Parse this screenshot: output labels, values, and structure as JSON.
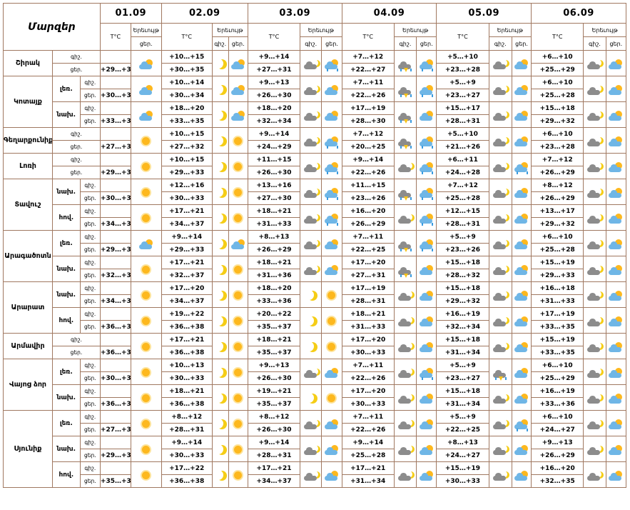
{
  "table_title": "Մարզեր",
  "header_labels": {
    "temp": "T°C",
    "weather": "Երեւույթ",
    "day": "ցեր.",
    "night": "գիշ."
  },
  "dates": [
    "01.09",
    "02.09",
    "03.09",
    "04.09",
    "05.09",
    "06.09"
  ],
  "icon_legend": {
    "sun": "sunny",
    "moon": "clear-night",
    "sun-cloud": "partly-cloudy-day",
    "moon-cloud": "partly-cloudy-night",
    "sun-cloud-rain": "sun-cloud-rain",
    "cloud-rain-thunder": "thunderstorm-rain"
  },
  "colors": {
    "border": "#a07860",
    "sun": "#fdb81e",
    "moon": "#f5cd16",
    "cloud_light": "#6fb6e6",
    "cloud_dark": "#8c8c8c",
    "rain": "#3a9be0"
  },
  "regions": [
    {
      "name": "Շիրակ",
      "subs": [
        {
          "label": "",
          "night_label": "գիշ.",
          "day_label": "ցեր.",
          "d1": {
            "temp": "+29…+34",
            "icon": "sun-cloud"
          },
          "days": [
            {
              "night": "+10…+15",
              "day": "+30…+35",
              "night_icon": "moon",
              "day_icon": "sun-cloud"
            },
            {
              "night": "+9…+14",
              "day": "+27…+31",
              "night_icon": "moon-cloud",
              "day_icon": "sun-cloud-rain"
            },
            {
              "night": "+7…+12",
              "day": "+22…+27",
              "night_icon": "cloud-rain-thunder",
              "day_icon": "sun-cloud-rain"
            },
            {
              "night": "+5…+10",
              "day": "+23…+28",
              "night_icon": "moon-cloud",
              "day_icon": "sun-cloud"
            },
            {
              "night": "+6…+10",
              "day": "+25…+29",
              "night_icon": "moon-cloud",
              "day_icon": "sun-cloud"
            }
          ]
        }
      ]
    },
    {
      "name": "Կոտայք",
      "subs": [
        {
          "label": "լեռ.",
          "night_label": "գիշ.",
          "day_label": "ցեր.",
          "d1": {
            "temp": "+30…+33",
            "icon": "sun-cloud"
          },
          "days": [
            {
              "night": "+10…+14",
              "day": "+30…+34",
              "night_icon": "moon",
              "day_icon": "sun-cloud"
            },
            {
              "night": "+9…+13",
              "day": "+26…+30",
              "night_icon": "moon-cloud",
              "day_icon": "sun-cloud"
            },
            {
              "night": "+7…+11",
              "day": "+22…+26",
              "night_icon": "cloud-rain-thunder",
              "day_icon": "sun-cloud-rain"
            },
            {
              "night": "+5…+9",
              "day": "+23…+27",
              "night_icon": "moon-cloud",
              "day_icon": "sun-cloud"
            },
            {
              "night": "+6…+10",
              "day": "+25…+28",
              "night_icon": "moon-cloud",
              "day_icon": "sun-cloud"
            }
          ]
        },
        {
          "label": "նախ.",
          "night_label": "գիշ.",
          "day_label": "ցեր.",
          "d1": {
            "temp": "+33…+35",
            "icon": "sun-cloud"
          },
          "days": [
            {
              "night": "+18…+20",
              "day": "+33…+35",
              "night_icon": "moon",
              "day_icon": "sun-cloud"
            },
            {
              "night": "+18…+20",
              "day": "+32…+34",
              "night_icon": "moon-cloud",
              "day_icon": "sun-cloud"
            },
            {
              "night": "+17…+19",
              "day": "+28…+30",
              "night_icon": "cloud-rain-thunder",
              "day_icon": "sun-cloud"
            },
            {
              "night": "+15…+17",
              "day": "+28…+31",
              "night_icon": "moon-cloud",
              "day_icon": "sun-cloud"
            },
            {
              "night": "+15…+18",
              "day": "+29…+32",
              "night_icon": "moon-cloud",
              "day_icon": "sun-cloud"
            }
          ]
        }
      ]
    },
    {
      "name": "Գեղարքունիք",
      "subs": [
        {
          "label": "",
          "night_label": "գիշ.",
          "day_label": "ցեր.",
          "d1": {
            "temp": "+27…+32",
            "icon": "sun"
          },
          "days": [
            {
              "night": "+10…+15",
              "day": "+27…+32",
              "night_icon": "moon",
              "day_icon": "sun"
            },
            {
              "night": "+9…+14",
              "day": "+24…+29",
              "night_icon": "moon-cloud",
              "day_icon": "sun-cloud-rain"
            },
            {
              "night": "+7…+12",
              "day": "+20…+25",
              "night_icon": "cloud-rain-thunder",
              "day_icon": "sun-cloud-rain"
            },
            {
              "night": "+5…+10",
              "day": "+21…+26",
              "night_icon": "moon-cloud",
              "day_icon": "sun-cloud"
            },
            {
              "night": "+6…+10",
              "day": "+23…+28",
              "night_icon": "moon-cloud",
              "day_icon": "sun-cloud"
            }
          ]
        }
      ]
    },
    {
      "name": "Լոռի",
      "subs": [
        {
          "label": "",
          "night_label": "գիշ.",
          "day_label": "ցեր.",
          "d1": {
            "temp": "+29…+33",
            "icon": "sun"
          },
          "days": [
            {
              "night": "+10…+15",
              "day": "+29…+33",
              "night_icon": "moon",
              "day_icon": "sun"
            },
            {
              "night": "+11…+15",
              "day": "+26…+30",
              "night_icon": "moon-cloud",
              "day_icon": "sun-cloud-rain"
            },
            {
              "night": "+9…+14",
              "day": "+22…+26",
              "night_icon": "moon-cloud",
              "day_icon": "sun-cloud-rain"
            },
            {
              "night": "+6…+11",
              "day": "+24…+28",
              "night_icon": "moon-cloud",
              "day_icon": "sun-cloud-rain"
            },
            {
              "night": "+7…+12",
              "day": "+26…+29",
              "night_icon": "moon-cloud",
              "day_icon": "sun-cloud"
            }
          ]
        }
      ]
    },
    {
      "name": "Տավուշ",
      "subs": [
        {
          "label": "նախ.",
          "night_label": "գիշ.",
          "day_label": "ցեր.",
          "d1": {
            "temp": "+30…+33",
            "icon": "sun"
          },
          "days": [
            {
              "night": "+12…+16",
              "day": "+30…+33",
              "night_icon": "moon",
              "day_icon": "sun"
            },
            {
              "night": "+13…+16",
              "day": "+27…+30",
              "night_icon": "moon-cloud",
              "day_icon": "sun-cloud-rain"
            },
            {
              "night": "+11…+15",
              "day": "+23…+26",
              "night_icon": "cloud-rain-thunder",
              "day_icon": "sun-cloud-rain"
            },
            {
              "night": "+7…+12",
              "day": "+25…+28",
              "night_icon": "moon-cloud",
              "day_icon": "sun-cloud"
            },
            {
              "night": "+8…+12",
              "day": "+26…+29",
              "night_icon": "moon-cloud",
              "day_icon": "sun-cloud"
            }
          ]
        },
        {
          "label": "հով.",
          "night_label": "գիշ.",
          "day_label": "ցեր.",
          "d1": {
            "temp": "+34…+37",
            "icon": "sun"
          },
          "days": [
            {
              "night": "+17…+21",
              "day": "+34…+37",
              "night_icon": "moon",
              "day_icon": "sun"
            },
            {
              "night": "+18…+21",
              "day": "+31…+33",
              "night_icon": "moon-cloud",
              "day_icon": "sun-cloud-rain"
            },
            {
              "night": "+16…+20",
              "day": "+26…+29",
              "night_icon": "moon-cloud",
              "day_icon": "sun-cloud-rain"
            },
            {
              "night": "+12…+15",
              "day": "+28…+31",
              "night_icon": "moon-cloud",
              "day_icon": "sun-cloud"
            },
            {
              "night": "+13…+17",
              "day": "+29…+32",
              "night_icon": "moon-cloud",
              "day_icon": "sun-cloud"
            }
          ]
        }
      ]
    },
    {
      "name": "Արագածոտն",
      "subs": [
        {
          "label": "լեռ.",
          "night_label": "գիշ.",
          "day_label": "ցեր.",
          "d1": {
            "temp": "+29…+33",
            "icon": "sun-cloud"
          },
          "days": [
            {
              "night": "+9…+14",
              "day": "+29…+33",
              "night_icon": "moon",
              "day_icon": "sun-cloud"
            },
            {
              "night": "+8…+13",
              "day": "+26…+29",
              "night_icon": "moon-cloud",
              "day_icon": "sun-cloud"
            },
            {
              "night": "+7…+11",
              "day": "+22…+25",
              "night_icon": "cloud-rain-thunder",
              "day_icon": "sun-cloud-rain"
            },
            {
              "night": "+5…+9",
              "day": "+23…+26",
              "night_icon": "moon-cloud",
              "day_icon": "sun-cloud"
            },
            {
              "night": "+6…+10",
              "day": "+25…+28",
              "night_icon": "moon-cloud",
              "day_icon": "sun-cloud"
            }
          ]
        },
        {
          "label": "նախ.",
          "night_label": "գիշ.",
          "day_label": "ցեր.",
          "d1": {
            "temp": "+32…+37",
            "icon": "sun"
          },
          "days": [
            {
              "night": "+17…+21",
              "day": "+32…+37",
              "night_icon": "moon",
              "day_icon": "sun"
            },
            {
              "night": "+18…+21",
              "day": "+31…+36",
              "night_icon": "moon-cloud",
              "day_icon": "sun-cloud"
            },
            {
              "night": "+17…+20",
              "day": "+27…+31",
              "night_icon": "cloud-rain-thunder",
              "day_icon": "sun-cloud"
            },
            {
              "night": "+15…+18",
              "day": "+28…+32",
              "night_icon": "moon-cloud",
              "day_icon": "sun-cloud"
            },
            {
              "night": "+15…+19",
              "day": "+29…+33",
              "night_icon": "moon-cloud",
              "day_icon": "sun-cloud"
            }
          ]
        }
      ]
    },
    {
      "name": "Արարատ",
      "subs": [
        {
          "label": "նախ.",
          "night_label": "գիշ.",
          "day_label": "ցեր.",
          "d1": {
            "temp": "+34…+37",
            "icon": "sun"
          },
          "days": [
            {
              "night": "+17…+20",
              "day": "+34…+37",
              "night_icon": "moon",
              "day_icon": "sun"
            },
            {
              "night": "+18…+20",
              "day": "+33…+36",
              "night_icon": "moon",
              "day_icon": "sun"
            },
            {
              "night": "+17…+19",
              "day": "+28…+31",
              "night_icon": "moon-cloud",
              "day_icon": "sun-cloud"
            },
            {
              "night": "+15…+18",
              "day": "+29…+32",
              "night_icon": "moon-cloud",
              "day_icon": "sun-cloud"
            },
            {
              "night": "+16…+18",
              "day": "+31…+33",
              "night_icon": "moon-cloud",
              "day_icon": "sun-cloud"
            }
          ]
        },
        {
          "label": "հով.",
          "night_label": "գիշ.",
          "day_label": "ցեր.",
          "d1": {
            "temp": "+36…+38",
            "icon": "sun"
          },
          "days": [
            {
              "night": "+19…+22",
              "day": "+36…+38",
              "night_icon": "moon",
              "day_icon": "sun"
            },
            {
              "night": "+20…+22",
              "day": "+35…+37",
              "night_icon": "moon",
              "day_icon": "sun"
            },
            {
              "night": "+18…+21",
              "day": "+31…+33",
              "night_icon": "moon-cloud",
              "day_icon": "sun-cloud"
            },
            {
              "night": "+16…+19",
              "day": "+32…+34",
              "night_icon": "moon-cloud",
              "day_icon": "sun-cloud"
            },
            {
              "night": "+17…+19",
              "day": "+33…+35",
              "night_icon": "moon-cloud",
              "day_icon": "sun-cloud"
            }
          ]
        }
      ]
    },
    {
      "name": "Արմավիր",
      "subs": [
        {
          "label": "",
          "night_label": "գիշ.",
          "day_label": "ցեր.",
          "d1": {
            "temp": "+36…+38",
            "icon": "sun"
          },
          "days": [
            {
              "night": "+17…+21",
              "day": "+36…+38",
              "night_icon": "moon",
              "day_icon": "sun"
            },
            {
              "night": "+18…+21",
              "day": "+35…+37",
              "night_icon": "moon",
              "day_icon": "sun"
            },
            {
              "night": "+17…+20",
              "day": "+30…+33",
              "night_icon": "moon-cloud",
              "day_icon": "sun-cloud"
            },
            {
              "night": "+15…+18",
              "day": "+31…+34",
              "night_icon": "moon-cloud",
              "day_icon": "sun-cloud"
            },
            {
              "night": "+15…+19",
              "day": "+33…+35",
              "night_icon": "moon-cloud",
              "day_icon": "sun-cloud"
            }
          ]
        }
      ]
    },
    {
      "name": "Վայոց ձոր",
      "subs": [
        {
          "label": "լեռ.",
          "night_label": "գիշ.",
          "day_label": "ցեր.",
          "d1": {
            "temp": "+30…+33",
            "icon": "sun"
          },
          "days": [
            {
              "night": "+10…+13",
              "day": "+30…+33",
              "night_icon": "moon",
              "day_icon": "sun"
            },
            {
              "night": "+9…+13",
              "day": "+26…+30",
              "night_icon": "moon-cloud",
              "day_icon": "sun-cloud"
            },
            {
              "night": "+7…+11",
              "day": "+22…+26",
              "night_icon": "moon-cloud",
              "day_icon": "sun-cloud-rain"
            },
            {
              "night": "+5…+9",
              "day": "+23…+27",
              "night_icon": "cloud-rain-thunder",
              "day_icon": "sun-cloud"
            },
            {
              "night": "+6…+10",
              "day": "+25…+29",
              "night_icon": "moon-cloud",
              "day_icon": "sun-cloud"
            }
          ]
        },
        {
          "label": "նախ.",
          "night_label": "գիշ.",
          "day_label": "ցեր.",
          "d1": {
            "temp": "+36…+38",
            "icon": "sun"
          },
          "days": [
            {
              "night": "+18…+21",
              "day": "+36…+38",
              "night_icon": "moon",
              "day_icon": "sun"
            },
            {
              "night": "+19…+21",
              "day": "+35…+37",
              "night_icon": "moon",
              "day_icon": "sun"
            },
            {
              "night": "+17…+20",
              "day": "+30…+33",
              "night_icon": "moon-cloud",
              "day_icon": "sun-cloud"
            },
            {
              "night": "+15…+18",
              "day": "+31…+34",
              "night_icon": "moon-cloud",
              "day_icon": "sun-cloud"
            },
            {
              "night": "+16…+19",
              "day": "+33…+36",
              "night_icon": "moon-cloud",
              "day_icon": "sun-cloud"
            }
          ]
        }
      ]
    },
    {
      "name": "Սյունիք",
      "subs": [
        {
          "label": "լեռ.",
          "night_label": "գիշ.",
          "day_label": "ցեր.",
          "d1": {
            "temp": "+27…+30",
            "icon": "sun"
          },
          "days": [
            {
              "night": "+8…+12",
              "day": "+28…+31",
              "night_icon": "moon",
              "day_icon": "sun"
            },
            {
              "night": "+8…+12",
              "day": "+26…+30",
              "night_icon": "moon-cloud",
              "day_icon": "sun-cloud"
            },
            {
              "night": "+7…+11",
              "day": "+22…+26",
              "night_icon": "moon-cloud",
              "day_icon": "sun-cloud"
            },
            {
              "night": "+5…+9",
              "day": "+22…+25",
              "night_icon": "moon-cloud",
              "day_icon": "sun-cloud-rain"
            },
            {
              "night": "+6…+10",
              "day": "+24…+27",
              "night_icon": "moon-cloud",
              "day_icon": "sun-cloud"
            }
          ]
        },
        {
          "label": "նախ.",
          "night_label": "գիշ.",
          "day_label": "ցեր.",
          "d1": {
            "temp": "+29…+32",
            "icon": "sun"
          },
          "days": [
            {
              "night": "+9…+14",
              "day": "+30…+33",
              "night_icon": "moon",
              "day_icon": "sun"
            },
            {
              "night": "+9…+14",
              "day": "+28…+31",
              "night_icon": "moon-cloud",
              "day_icon": "sun-cloud"
            },
            {
              "night": "+9…+14",
              "day": "+25…+28",
              "night_icon": "moon-cloud",
              "day_icon": "sun-cloud"
            },
            {
              "night": "+8…+13",
              "day": "+24…+27",
              "night_icon": "moon-cloud",
              "day_icon": "sun-cloud"
            },
            {
              "night": "+9…+13",
              "day": "+26…+29",
              "night_icon": "moon-cloud",
              "day_icon": "sun-cloud"
            }
          ]
        },
        {
          "label": "հով.",
          "night_label": "գիշ.",
          "day_label": "ցեր.",
          "d1": {
            "temp": "+35…+37",
            "icon": "sun"
          },
          "days": [
            {
              "night": "+17…+22",
              "day": "+36…+38",
              "night_icon": "moon",
              "day_icon": "sun"
            },
            {
              "night": "+17…+21",
              "day": "+34…+37",
              "night_icon": "moon-cloud",
              "day_icon": "sun-cloud"
            },
            {
              "night": "+17…+21",
              "day": "+31…+34",
              "night_icon": "moon-cloud",
              "day_icon": "sun-cloud"
            },
            {
              "night": "+15…+19",
              "day": "+30…+33",
              "night_icon": "moon-cloud",
              "day_icon": "sun-cloud"
            },
            {
              "night": "+16…+20",
              "day": "+32…+35",
              "night_icon": "moon-cloud",
              "day_icon": "sun-cloud"
            }
          ]
        }
      ]
    }
  ]
}
